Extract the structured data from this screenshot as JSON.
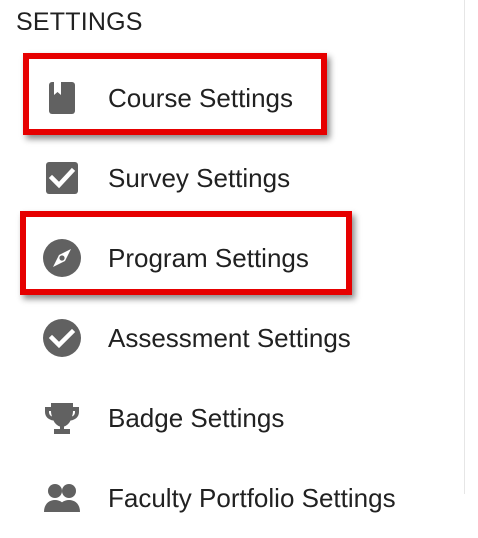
{
  "settings": {
    "title": "SETTINGS",
    "items": [
      {
        "label": "Course Settings",
        "icon": "book-icon"
      },
      {
        "label": "Survey Settings",
        "icon": "checkbox-icon"
      },
      {
        "label": "Program Settings",
        "icon": "compass-icon"
      },
      {
        "label": "Assessment Settings",
        "icon": "check-circle-icon"
      },
      {
        "label": "Badge Settings",
        "icon": "trophy-icon"
      },
      {
        "label": "Faculty Portfolio Settings",
        "icon": "people-icon"
      }
    ]
  },
  "colors": {
    "icon": "#616161",
    "text": "#212121",
    "highlight": "#e60000"
  }
}
